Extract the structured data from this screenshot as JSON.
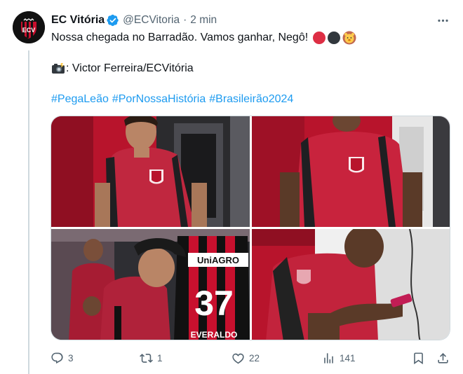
{
  "tweet": {
    "display_name": "EC Vitória",
    "handle": "@ECVitoria",
    "separator": "·",
    "timestamp": "2 min",
    "text_line1": "Nossa chegada no Barradão. Vamos ganhar, Negô!",
    "text_line1_emojis": [
      "red-circle",
      "black-circle",
      "lion-face"
    ],
    "camera_emoji": "camera-with-flash",
    "credit": ": Victor Ferreira/ECVitória",
    "hashtags": [
      "#PegaLeão",
      "#PorNossaHistória",
      "#Brasileirão2024"
    ],
    "photos": [
      {
        "name": "photo-player-arriving-1"
      },
      {
        "name": "photo-player-arriving-2"
      },
      {
        "name": "photo-players-shirt-37"
      },
      {
        "name": "photo-player-phone"
      }
    ],
    "jersey_sponsor": "UniAGRO",
    "jersey_number": "37",
    "jersey_nameplate": "EVERALDO",
    "actions": {
      "reply_count": "3",
      "repost_count": "1",
      "like_count": "22",
      "views_count": "141"
    }
  },
  "colors": {
    "text": "#0f1419",
    "secondary": "#536471",
    "link": "#1d9bf0",
    "border": "#cfd9de",
    "verified": "#1d9bf0",
    "club_red": "#c8102e",
    "club_black": "#111111"
  },
  "icons": {
    "verified": "verified-badge-icon",
    "more": "more-options-icon",
    "reply": "reply-icon",
    "repost": "repost-icon",
    "like": "heart-icon",
    "views": "views-icon",
    "bookmark": "bookmark-icon",
    "share": "share-icon"
  }
}
